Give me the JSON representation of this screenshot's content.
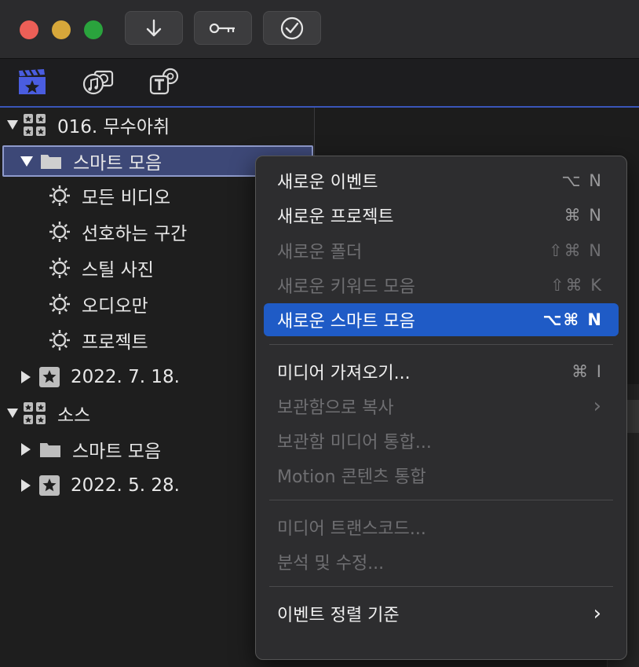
{
  "colors": {
    "selection_row": "#3d4877",
    "menu_highlight": "#1f5bc6",
    "accent_line": "#3a55b8"
  },
  "toolbar": {
    "buttons": [
      "import-arrow-icon",
      "key-icon",
      "checkmark-icon"
    ]
  },
  "iconbar": {
    "items": [
      "libraries-icon",
      "photos-audio-icon",
      "titles-generators-icon"
    ]
  },
  "sidebar": {
    "library1": {
      "label": "016. 무수아취"
    },
    "smart_collection_folder": {
      "label": "스마트 모음"
    },
    "smart_items": [
      {
        "label": "모든 비디오"
      },
      {
        "label": "선호하는 구간"
      },
      {
        "label": "스틸 사진"
      },
      {
        "label": "오디오만"
      },
      {
        "label": "프로젝트"
      }
    ],
    "event1": {
      "label": "2022. 7. 18."
    },
    "library2": {
      "label": "소스"
    },
    "folder2": {
      "label": "스마트 모음"
    },
    "event2": {
      "label": "2022. 5. 28."
    }
  },
  "menu": {
    "items": [
      {
        "label": "새로운 이벤트",
        "shortcut": "⌥ N"
      },
      {
        "label": "새로운 프로젝트",
        "shortcut": "⌘ N"
      },
      {
        "label": "새로운 폴더",
        "shortcut": "⇧⌘ N"
      },
      {
        "label": "새로운 키워드 모음",
        "shortcut": "⇧⌘ K"
      },
      {
        "label": "새로운 스마트 모음",
        "shortcut": "⌥⌘ N"
      },
      {
        "label": "미디어 가져오기...",
        "shortcut": "⌘ I"
      },
      {
        "label": "보관함으로 복사",
        "shortcut": "›"
      },
      {
        "label": "보관함 미디어 통합..."
      },
      {
        "label": "Motion 콘텐츠 통합"
      },
      {
        "label": "미디어 트랜스코드..."
      },
      {
        "label": "분석 및 수정..."
      },
      {
        "label": "이벤트 정렬 기준",
        "shortcut": "›"
      }
    ]
  }
}
